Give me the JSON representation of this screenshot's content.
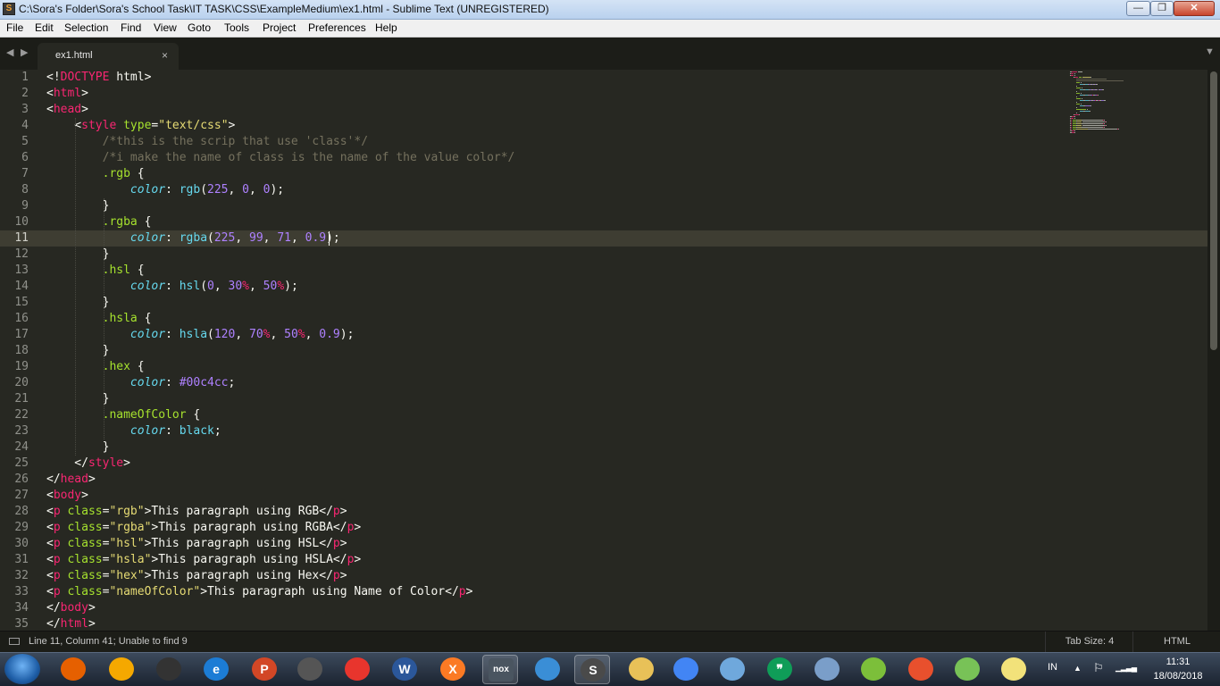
{
  "window": {
    "title": "C:\\Sora's Folder\\Sora's School Task\\IT TASK\\CSS\\ExampleMedium\\ex1.html - Sublime Text (UNREGISTERED)",
    "minimize_label": "—",
    "maximize_label": "❐",
    "close_label": "✕"
  },
  "menu": [
    "File",
    "Edit",
    "Selection",
    "Find",
    "View",
    "Goto",
    "Tools",
    "Project",
    "Preferences",
    "Help"
  ],
  "tabs": {
    "nav_back": "◀",
    "nav_forward": "▶",
    "active_tab": "ex1.html",
    "close_glyph": "×",
    "dropdown": "▼"
  },
  "editor": {
    "current_line": 11,
    "lines": [
      [
        {
          "c": "t",
          "v": "<!"
        },
        {
          "c": "t tag",
          "v": "DOCTYPE"
        },
        {
          "c": "t",
          "v": " html>"
        }
      ],
      [
        {
          "c": "t",
          "v": "<"
        },
        {
          "c": "t tag",
          "v": "html"
        },
        {
          "c": "t",
          "v": ">"
        }
      ],
      [
        {
          "c": "t",
          "v": "<"
        },
        {
          "c": "t tag",
          "v": "head"
        },
        {
          "c": "t",
          "v": ">"
        }
      ],
      [
        {
          "c": "t",
          "v": "    <"
        },
        {
          "c": "t tag",
          "v": "style"
        },
        {
          "c": "t",
          "v": " "
        },
        {
          "c": "t attr",
          "v": "type"
        },
        {
          "c": "t",
          "v": "="
        },
        {
          "c": "t str",
          "v": "\"text/css\""
        },
        {
          "c": "t",
          "v": ">"
        }
      ],
      [
        {
          "c": "t cmt",
          "v": "        /*this is the scrip that use 'class'*/"
        }
      ],
      [
        {
          "c": "t cmt",
          "v": "        /*i make the name of class is the name of the value color*/"
        }
      ],
      [
        {
          "c": "t sel",
          "v": "        .rgb"
        },
        {
          "c": "t",
          "v": " {"
        }
      ],
      [
        {
          "c": "t",
          "v": "            "
        },
        {
          "c": "t prop",
          "v": "color"
        },
        {
          "c": "t",
          "v": ": "
        },
        {
          "c": "t fn",
          "v": "rgb"
        },
        {
          "c": "t",
          "v": "("
        },
        {
          "c": "t num",
          "v": "225"
        },
        {
          "c": "t",
          "v": ", "
        },
        {
          "c": "t num",
          "v": "0"
        },
        {
          "c": "t",
          "v": ", "
        },
        {
          "c": "t num",
          "v": "0"
        },
        {
          "c": "t",
          "v": ");"
        }
      ],
      [
        {
          "c": "t",
          "v": "        }"
        }
      ],
      [
        {
          "c": "t sel",
          "v": "        .rgba"
        },
        {
          "c": "t",
          "v": " {"
        }
      ],
      [
        {
          "c": "t",
          "v": "            "
        },
        {
          "c": "t prop",
          "v": "color"
        },
        {
          "c": "t",
          "v": ": "
        },
        {
          "c": "t fn",
          "v": "rgba"
        },
        {
          "c": "t",
          "v": "("
        },
        {
          "c": "t num",
          "v": "225"
        },
        {
          "c": "t",
          "v": ", "
        },
        {
          "c": "t num",
          "v": "99"
        },
        {
          "c": "t",
          "v": ", "
        },
        {
          "c": "t num",
          "v": "71"
        },
        {
          "c": "t",
          "v": ", "
        },
        {
          "c": "t num",
          "v": "0.9"
        },
        {
          "c": "t",
          "v": ");"
        }
      ],
      [
        {
          "c": "t",
          "v": "        }"
        }
      ],
      [
        {
          "c": "t sel",
          "v": "        .hsl"
        },
        {
          "c": "t",
          "v": " {"
        }
      ],
      [
        {
          "c": "t",
          "v": "            "
        },
        {
          "c": "t prop",
          "v": "color"
        },
        {
          "c": "t",
          "v": ": "
        },
        {
          "c": "t fn",
          "v": "hsl"
        },
        {
          "c": "t",
          "v": "("
        },
        {
          "c": "t num",
          "v": "0"
        },
        {
          "c": "t",
          "v": ", "
        },
        {
          "c": "t num",
          "v": "30"
        },
        {
          "c": "t unit",
          "v": "%"
        },
        {
          "c": "t",
          "v": ", "
        },
        {
          "c": "t num",
          "v": "50"
        },
        {
          "c": "t unit",
          "v": "%"
        },
        {
          "c": "t",
          "v": ");"
        }
      ],
      [
        {
          "c": "t",
          "v": "        }"
        }
      ],
      [
        {
          "c": "t sel",
          "v": "        .hsla"
        },
        {
          "c": "t",
          "v": " {"
        }
      ],
      [
        {
          "c": "t",
          "v": "            "
        },
        {
          "c": "t prop",
          "v": "color"
        },
        {
          "c": "t",
          "v": ": "
        },
        {
          "c": "t fn",
          "v": "hsla"
        },
        {
          "c": "t",
          "v": "("
        },
        {
          "c": "t num",
          "v": "120"
        },
        {
          "c": "t",
          "v": ", "
        },
        {
          "c": "t num",
          "v": "70"
        },
        {
          "c": "t unit",
          "v": "%"
        },
        {
          "c": "t",
          "v": ", "
        },
        {
          "c": "t num",
          "v": "50"
        },
        {
          "c": "t unit",
          "v": "%"
        },
        {
          "c": "t",
          "v": ", "
        },
        {
          "c": "t num",
          "v": "0.9"
        },
        {
          "c": "t",
          "v": ");"
        }
      ],
      [
        {
          "c": "t",
          "v": "        }"
        }
      ],
      [
        {
          "c": "t sel",
          "v": "        .hex"
        },
        {
          "c": "t",
          "v": " {"
        }
      ],
      [
        {
          "c": "t",
          "v": "            "
        },
        {
          "c": "t prop",
          "v": "color"
        },
        {
          "c": "t",
          "v": ": "
        },
        {
          "c": "t num",
          "v": "#00c4cc"
        },
        {
          "c": "t",
          "v": ";"
        }
      ],
      [
        {
          "c": "t",
          "v": "        }"
        }
      ],
      [
        {
          "c": "t sel",
          "v": "        .nameOfColor"
        },
        {
          "c": "t",
          "v": " {"
        }
      ],
      [
        {
          "c": "t",
          "v": "            "
        },
        {
          "c": "t prop",
          "v": "color"
        },
        {
          "c": "t",
          "v": ": "
        },
        {
          "c": "t fn",
          "v": "black"
        },
        {
          "c": "t",
          "v": ";"
        }
      ],
      [
        {
          "c": "t",
          "v": "        }"
        }
      ],
      [
        {
          "c": "t",
          "v": "    </"
        },
        {
          "c": "t tag",
          "v": "style"
        },
        {
          "c": "t",
          "v": ">"
        }
      ],
      [
        {
          "c": "t",
          "v": "</"
        },
        {
          "c": "t tag",
          "v": "head"
        },
        {
          "c": "t",
          "v": ">"
        }
      ],
      [
        {
          "c": "t",
          "v": "<"
        },
        {
          "c": "t tag",
          "v": "body"
        },
        {
          "c": "t",
          "v": ">"
        }
      ],
      [
        {
          "c": "t",
          "v": "<"
        },
        {
          "c": "t tag",
          "v": "p"
        },
        {
          "c": "t",
          "v": " "
        },
        {
          "c": "t attr",
          "v": "class"
        },
        {
          "c": "t",
          "v": "="
        },
        {
          "c": "t str",
          "v": "\"rgb\""
        },
        {
          "c": "t",
          "v": ">This paragraph using RGB</"
        },
        {
          "c": "t tag",
          "v": "p"
        },
        {
          "c": "t",
          "v": ">"
        }
      ],
      [
        {
          "c": "t",
          "v": "<"
        },
        {
          "c": "t tag",
          "v": "p"
        },
        {
          "c": "t",
          "v": " "
        },
        {
          "c": "t attr",
          "v": "class"
        },
        {
          "c": "t",
          "v": "="
        },
        {
          "c": "t str",
          "v": "\"rgba\""
        },
        {
          "c": "t",
          "v": ">This paragraph using RGBA</"
        },
        {
          "c": "t tag",
          "v": "p"
        },
        {
          "c": "t",
          "v": ">"
        }
      ],
      [
        {
          "c": "t",
          "v": "<"
        },
        {
          "c": "t tag",
          "v": "p"
        },
        {
          "c": "t",
          "v": " "
        },
        {
          "c": "t attr",
          "v": "class"
        },
        {
          "c": "t",
          "v": "="
        },
        {
          "c": "t str",
          "v": "\"hsl\""
        },
        {
          "c": "t",
          "v": ">This paragraph using HSL</"
        },
        {
          "c": "t tag",
          "v": "p"
        },
        {
          "c": "t",
          "v": ">"
        }
      ],
      [
        {
          "c": "t",
          "v": "<"
        },
        {
          "c": "t tag",
          "v": "p"
        },
        {
          "c": "t",
          "v": " "
        },
        {
          "c": "t attr",
          "v": "class"
        },
        {
          "c": "t",
          "v": "="
        },
        {
          "c": "t str",
          "v": "\"hsla\""
        },
        {
          "c": "t",
          "v": ">This paragraph using HSLA</"
        },
        {
          "c": "t tag",
          "v": "p"
        },
        {
          "c": "t",
          "v": ">"
        }
      ],
      [
        {
          "c": "t",
          "v": "<"
        },
        {
          "c": "t tag",
          "v": "p"
        },
        {
          "c": "t",
          "v": " "
        },
        {
          "c": "t attr",
          "v": "class"
        },
        {
          "c": "t",
          "v": "="
        },
        {
          "c": "t str",
          "v": "\"hex\""
        },
        {
          "c": "t",
          "v": ">This paragraph using Hex</"
        },
        {
          "c": "t tag",
          "v": "p"
        },
        {
          "c": "t",
          "v": ">"
        }
      ],
      [
        {
          "c": "t",
          "v": "<"
        },
        {
          "c": "t tag",
          "v": "p"
        },
        {
          "c": "t",
          "v": " "
        },
        {
          "c": "t attr",
          "v": "class"
        },
        {
          "c": "t",
          "v": "="
        },
        {
          "c": "t str",
          "v": "\"nameOfColor\""
        },
        {
          "c": "t",
          "v": ">This paragraph using Name of Color</"
        },
        {
          "c": "t tag",
          "v": "p"
        },
        {
          "c": "t",
          "v": ">"
        }
      ],
      [
        {
          "c": "t",
          "v": "</"
        },
        {
          "c": "t tag",
          "v": "body"
        },
        {
          "c": "t",
          "v": ">"
        }
      ],
      [
        {
          "c": "t",
          "v": "</"
        },
        {
          "c": "t tag",
          "v": "html"
        },
        {
          "c": "t",
          "v": ">"
        }
      ]
    ]
  },
  "status_bar": {
    "status_text": "Line 11, Column 41; Unable to find 9",
    "tab_size": "Tab Size: 4",
    "syntax": "HTML"
  },
  "taskbar": {
    "apps": [
      {
        "name": "firefox-icon",
        "color": "#e66000",
        "glyph": ""
      },
      {
        "name": "xampp-sun-icon",
        "color": "#f5a800",
        "glyph": ""
      },
      {
        "name": "unity-icon",
        "color": "#333333",
        "glyph": ""
      },
      {
        "name": "internet-explorer-icon",
        "color": "#1c7cd5",
        "glyph": "e"
      },
      {
        "name": "powerpoint-icon",
        "color": "#d24726",
        "glyph": "P"
      },
      {
        "name": "microphone-icon",
        "color": "#555555",
        "glyph": ""
      },
      {
        "name": "camera-app-icon",
        "color": "#e8352d",
        "glyph": ""
      },
      {
        "name": "word-icon",
        "color": "#2b579a",
        "glyph": "W"
      },
      {
        "name": "xampp-icon",
        "color": "#fb7a24",
        "glyph": "X"
      },
      {
        "name": "nox-icon",
        "color": "#4a5560",
        "glyph": "nox"
      },
      {
        "name": "media-player-icon",
        "color": "#3a8ed6",
        "glyph": ""
      },
      {
        "name": "sublime-text-icon",
        "color": "#4a4a4a",
        "glyph": "S"
      },
      {
        "name": "file-explorer-icon",
        "color": "#e8c158",
        "glyph": ""
      },
      {
        "name": "chrome-icon",
        "color": "#4285f4",
        "glyph": ""
      },
      {
        "name": "notepad-icon",
        "color": "#6fa8dc",
        "glyph": ""
      },
      {
        "name": "hangouts-icon",
        "color": "#0f9d58",
        "glyph": "❞"
      },
      {
        "name": "paint-icon",
        "color": "#7a9ec9",
        "glyph": ""
      },
      {
        "name": "green-app-icon",
        "color": "#7cbf3a",
        "glyph": ""
      },
      {
        "name": "tool-app-icon",
        "color": "#e8502d",
        "glyph": ""
      },
      {
        "name": "android-studio-icon",
        "color": "#78c257",
        "glyph": ""
      },
      {
        "name": "sticky-notes-icon",
        "color": "#f2e27a",
        "glyph": ""
      }
    ],
    "tray": {
      "language": "IN",
      "arrow": "▲",
      "action_center": "⚐",
      "signal": "▁▂▃▄",
      "time": "11:31",
      "date": "18/08/2018"
    }
  }
}
